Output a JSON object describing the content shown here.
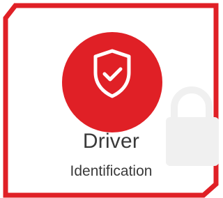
{
  "card": {
    "title": "Driver",
    "subtitle": "Identification",
    "icon": "shield-check-icon",
    "watermark_icon": "lock-icon"
  },
  "colors": {
    "accent": "#e02026",
    "text": "#3a3a3a",
    "background": "#ffffff",
    "watermark": "#f0f0f0"
  }
}
